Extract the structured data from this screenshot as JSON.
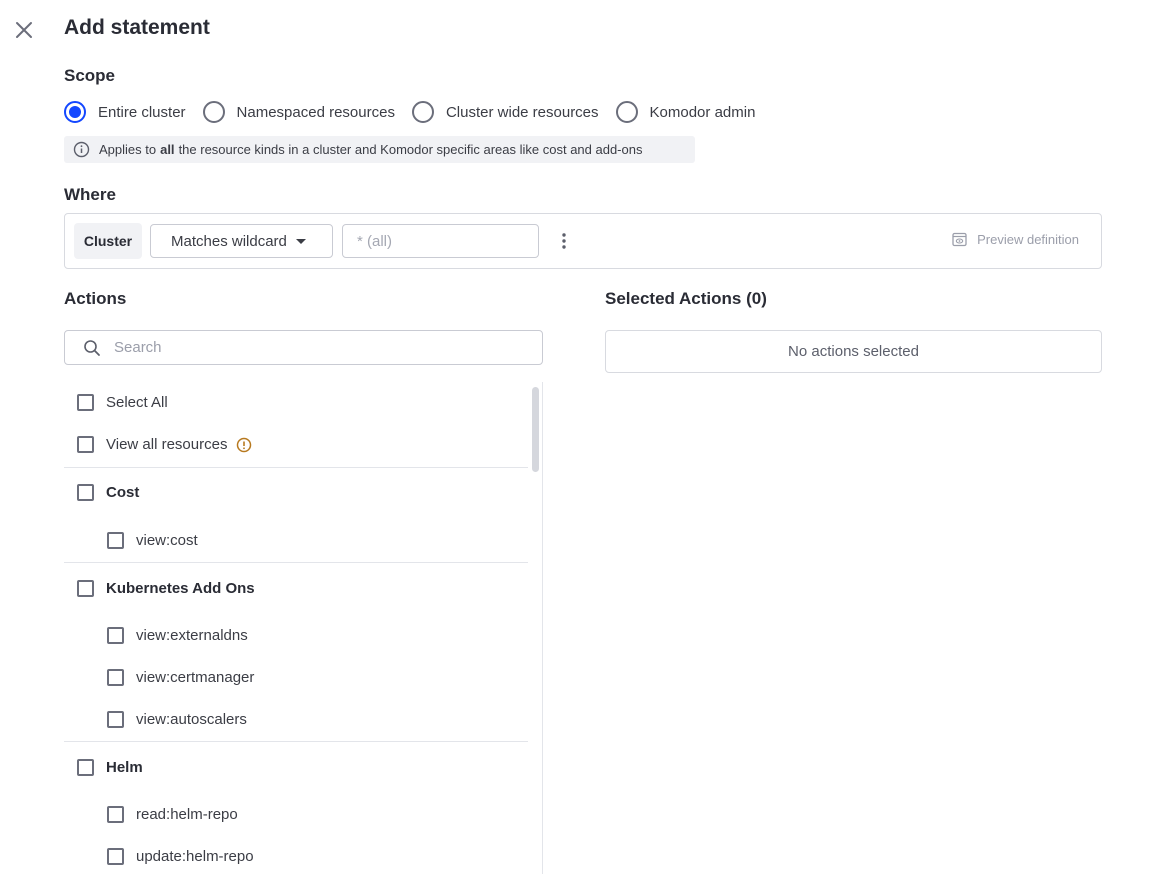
{
  "title": "Add statement",
  "scope": {
    "label": "Scope",
    "options": [
      "Entire cluster",
      "Namespaced resources",
      "Cluster wide resources",
      "Komodor admin"
    ],
    "selected": "Entire cluster",
    "info_prefix": "Applies to",
    "info_bold": "all",
    "info_suffix": "the resource kinds in a cluster and Komodor specific areas like cost and add-ons"
  },
  "where": {
    "label": "Where",
    "field": "Cluster",
    "operator": "Matches wildcard",
    "value_placeholder": "* (all)",
    "preview_label": "Preview definition"
  },
  "actions": {
    "label": "Actions",
    "search_placeholder": "Search",
    "select_all": "Select All",
    "view_all_resources": "View all resources",
    "groups": [
      {
        "name": "Cost",
        "items": [
          "view:cost"
        ]
      },
      {
        "name": "Kubernetes Add Ons",
        "items": [
          "view:externaldns",
          "view:certmanager",
          "view:autoscalers"
        ]
      },
      {
        "name": "Helm",
        "items": [
          "read:helm-repo",
          "update:helm-repo"
        ]
      }
    ]
  },
  "selected_actions": {
    "title": "Selected Actions (0)",
    "empty_text": "No actions selected"
  },
  "colors": {
    "accent": "#1347ff",
    "warning": "#b7791f"
  },
  "icons": [
    "close-icon",
    "info-icon",
    "chevron-down-icon",
    "more-vertical-icon",
    "preview-icon",
    "search-icon",
    "warning-icon"
  ]
}
